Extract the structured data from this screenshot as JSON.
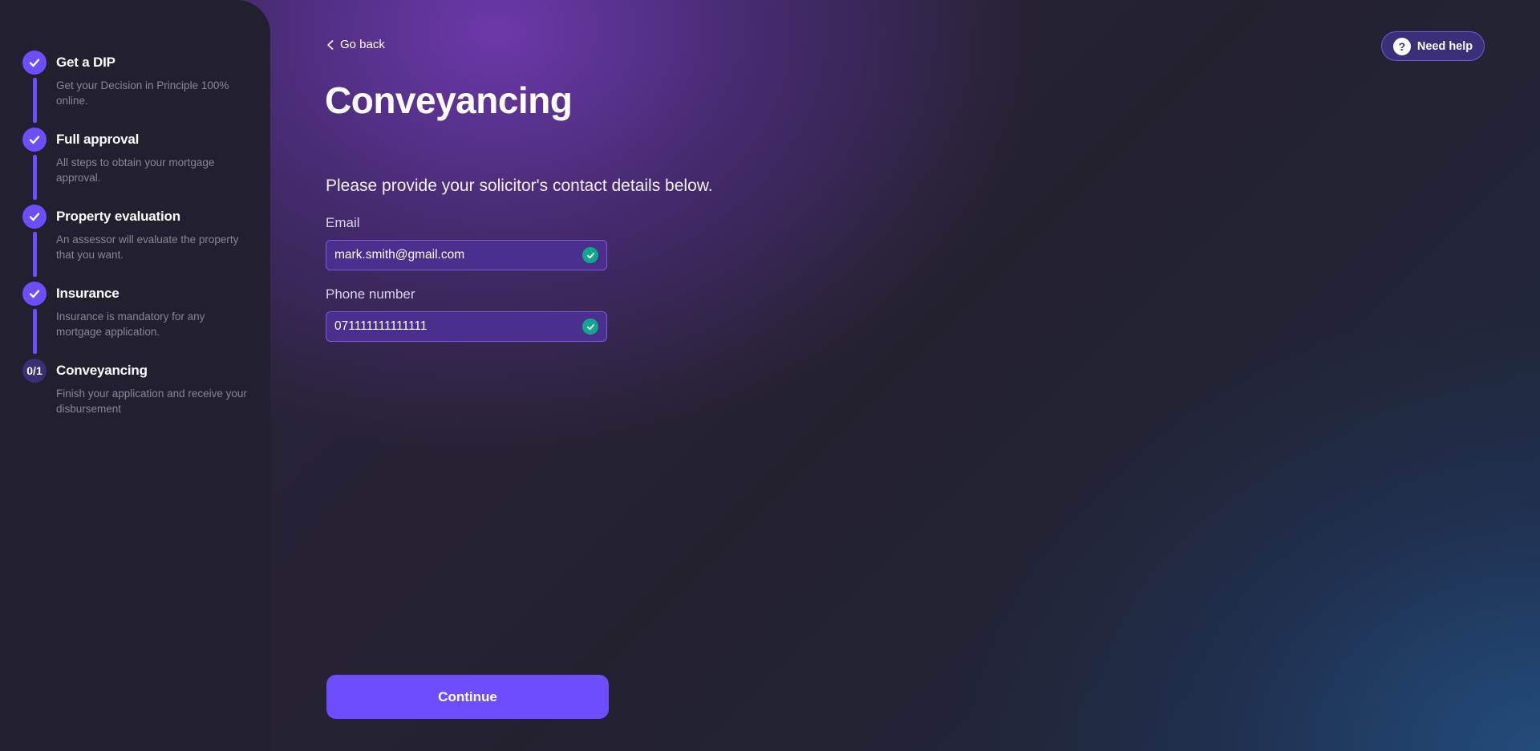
{
  "sidebar": {
    "steps": [
      {
        "title": "Get a DIP",
        "description": "Get your Decision in Principle 100% online.",
        "status": "complete"
      },
      {
        "title": "Full approval",
        "description": "All steps to obtain your mortgage approval.",
        "status": "complete"
      },
      {
        "title": "Property evaluation",
        "description": "An assessor will evaluate the property that you want.",
        "status": "complete"
      },
      {
        "title": "Insurance",
        "description": "Insurance is mandatory for any mortgage application.",
        "status": "complete"
      },
      {
        "title": "Conveyancing",
        "description": "Finish your application and receive your disbursement",
        "status": "current",
        "progress": "0/1"
      }
    ]
  },
  "header": {
    "back_label": "Go back",
    "help_label": "Need help",
    "help_icon_glyph": "?"
  },
  "main": {
    "title": "Conveyancing",
    "instruction": "Please provide your solicitor's contact details below.",
    "email": {
      "label": "Email",
      "value": "mark.smith@gmail.com",
      "valid": true
    },
    "phone": {
      "label": "Phone number",
      "value": "071111111111111",
      "valid": true
    },
    "continue_label": "Continue"
  },
  "colors": {
    "accent": "#6e4dff",
    "success": "#13a68e",
    "sidebar_bg": "#221f2e"
  }
}
